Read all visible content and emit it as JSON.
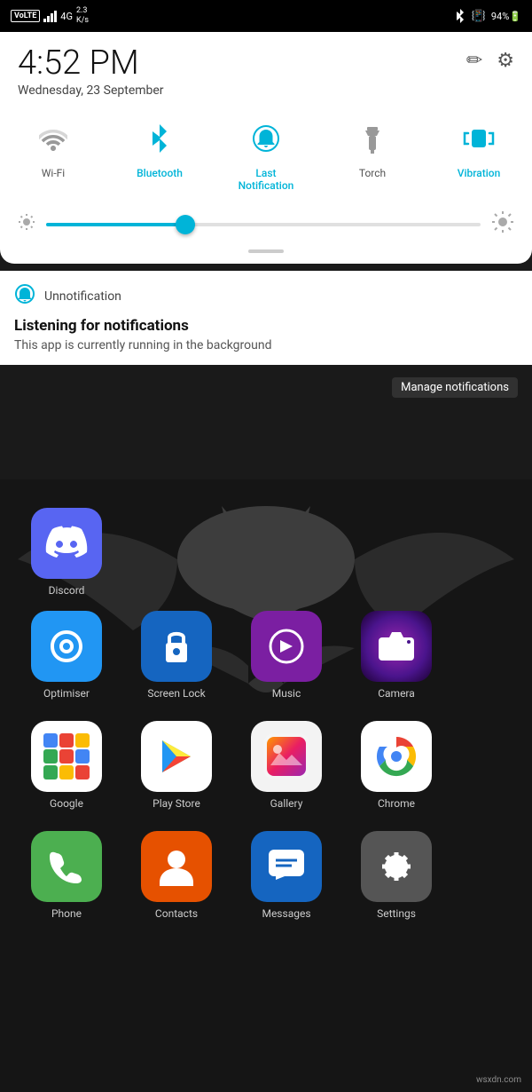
{
  "statusBar": {
    "left": {
      "volte": "VoLTE",
      "bars": "4G",
      "speed": "2.3\nK/s"
    },
    "right": {
      "bluetooth": "bluetooth",
      "vibration": "vibration",
      "battery": "94"
    }
  },
  "quickSettings": {
    "time": "4:52 PM",
    "date": "Wednesday, 23 September",
    "editIcon": "✏",
    "settingsIcon": "⚙",
    "toggles": [
      {
        "id": "wifi",
        "label": "Wi-Fi",
        "active": false,
        "icon": "wifi"
      },
      {
        "id": "bluetooth",
        "label": "Bluetooth",
        "active": true,
        "icon": "bluetooth"
      },
      {
        "id": "lastnotification",
        "label": "Last\nNotification",
        "active": true,
        "icon": "notification"
      },
      {
        "id": "torch",
        "label": "Torch",
        "active": false,
        "icon": "torch"
      },
      {
        "id": "vibration",
        "label": "Vibration",
        "active": true,
        "icon": "vibration"
      }
    ],
    "brightness": {
      "value": 32
    }
  },
  "notification": {
    "appName": "Unnotification",
    "title": "Listening for notifications",
    "description": "This app is currently running in the background",
    "manageLabel": "Manage notifications"
  },
  "apps": {
    "row1": [
      {
        "id": "discord",
        "label": "Discord",
        "color": "#5865F2"
      }
    ],
    "row2": [
      {
        "id": "optimiser",
        "label": "Optimiser",
        "color": "#2196F3"
      },
      {
        "id": "screenlock",
        "label": "Screen Lock",
        "color": "#1565C0"
      },
      {
        "id": "music",
        "label": "Music",
        "color": "#7B1FA2"
      },
      {
        "id": "camera",
        "label": "Camera",
        "color": "#4A148C"
      }
    ],
    "row3": [
      {
        "id": "google",
        "label": "Google",
        "color": "#fff"
      },
      {
        "id": "playstore",
        "label": "Play Store",
        "color": "#fff"
      },
      {
        "id": "gallery",
        "label": "Gallery",
        "color": "#F3F3F3"
      },
      {
        "id": "chrome",
        "label": "Chrome",
        "color": "#fff"
      }
    ],
    "row4": [
      {
        "id": "phone",
        "label": "Phone",
        "color": "#4CAF50"
      },
      {
        "id": "contacts",
        "label": "Contacts",
        "color": "#E65100"
      },
      {
        "id": "messages",
        "label": "Messages",
        "color": "#1565C0"
      },
      {
        "id": "settings",
        "label": "Settings",
        "color": "#555"
      }
    ]
  },
  "watermark": "wsxdn.com"
}
